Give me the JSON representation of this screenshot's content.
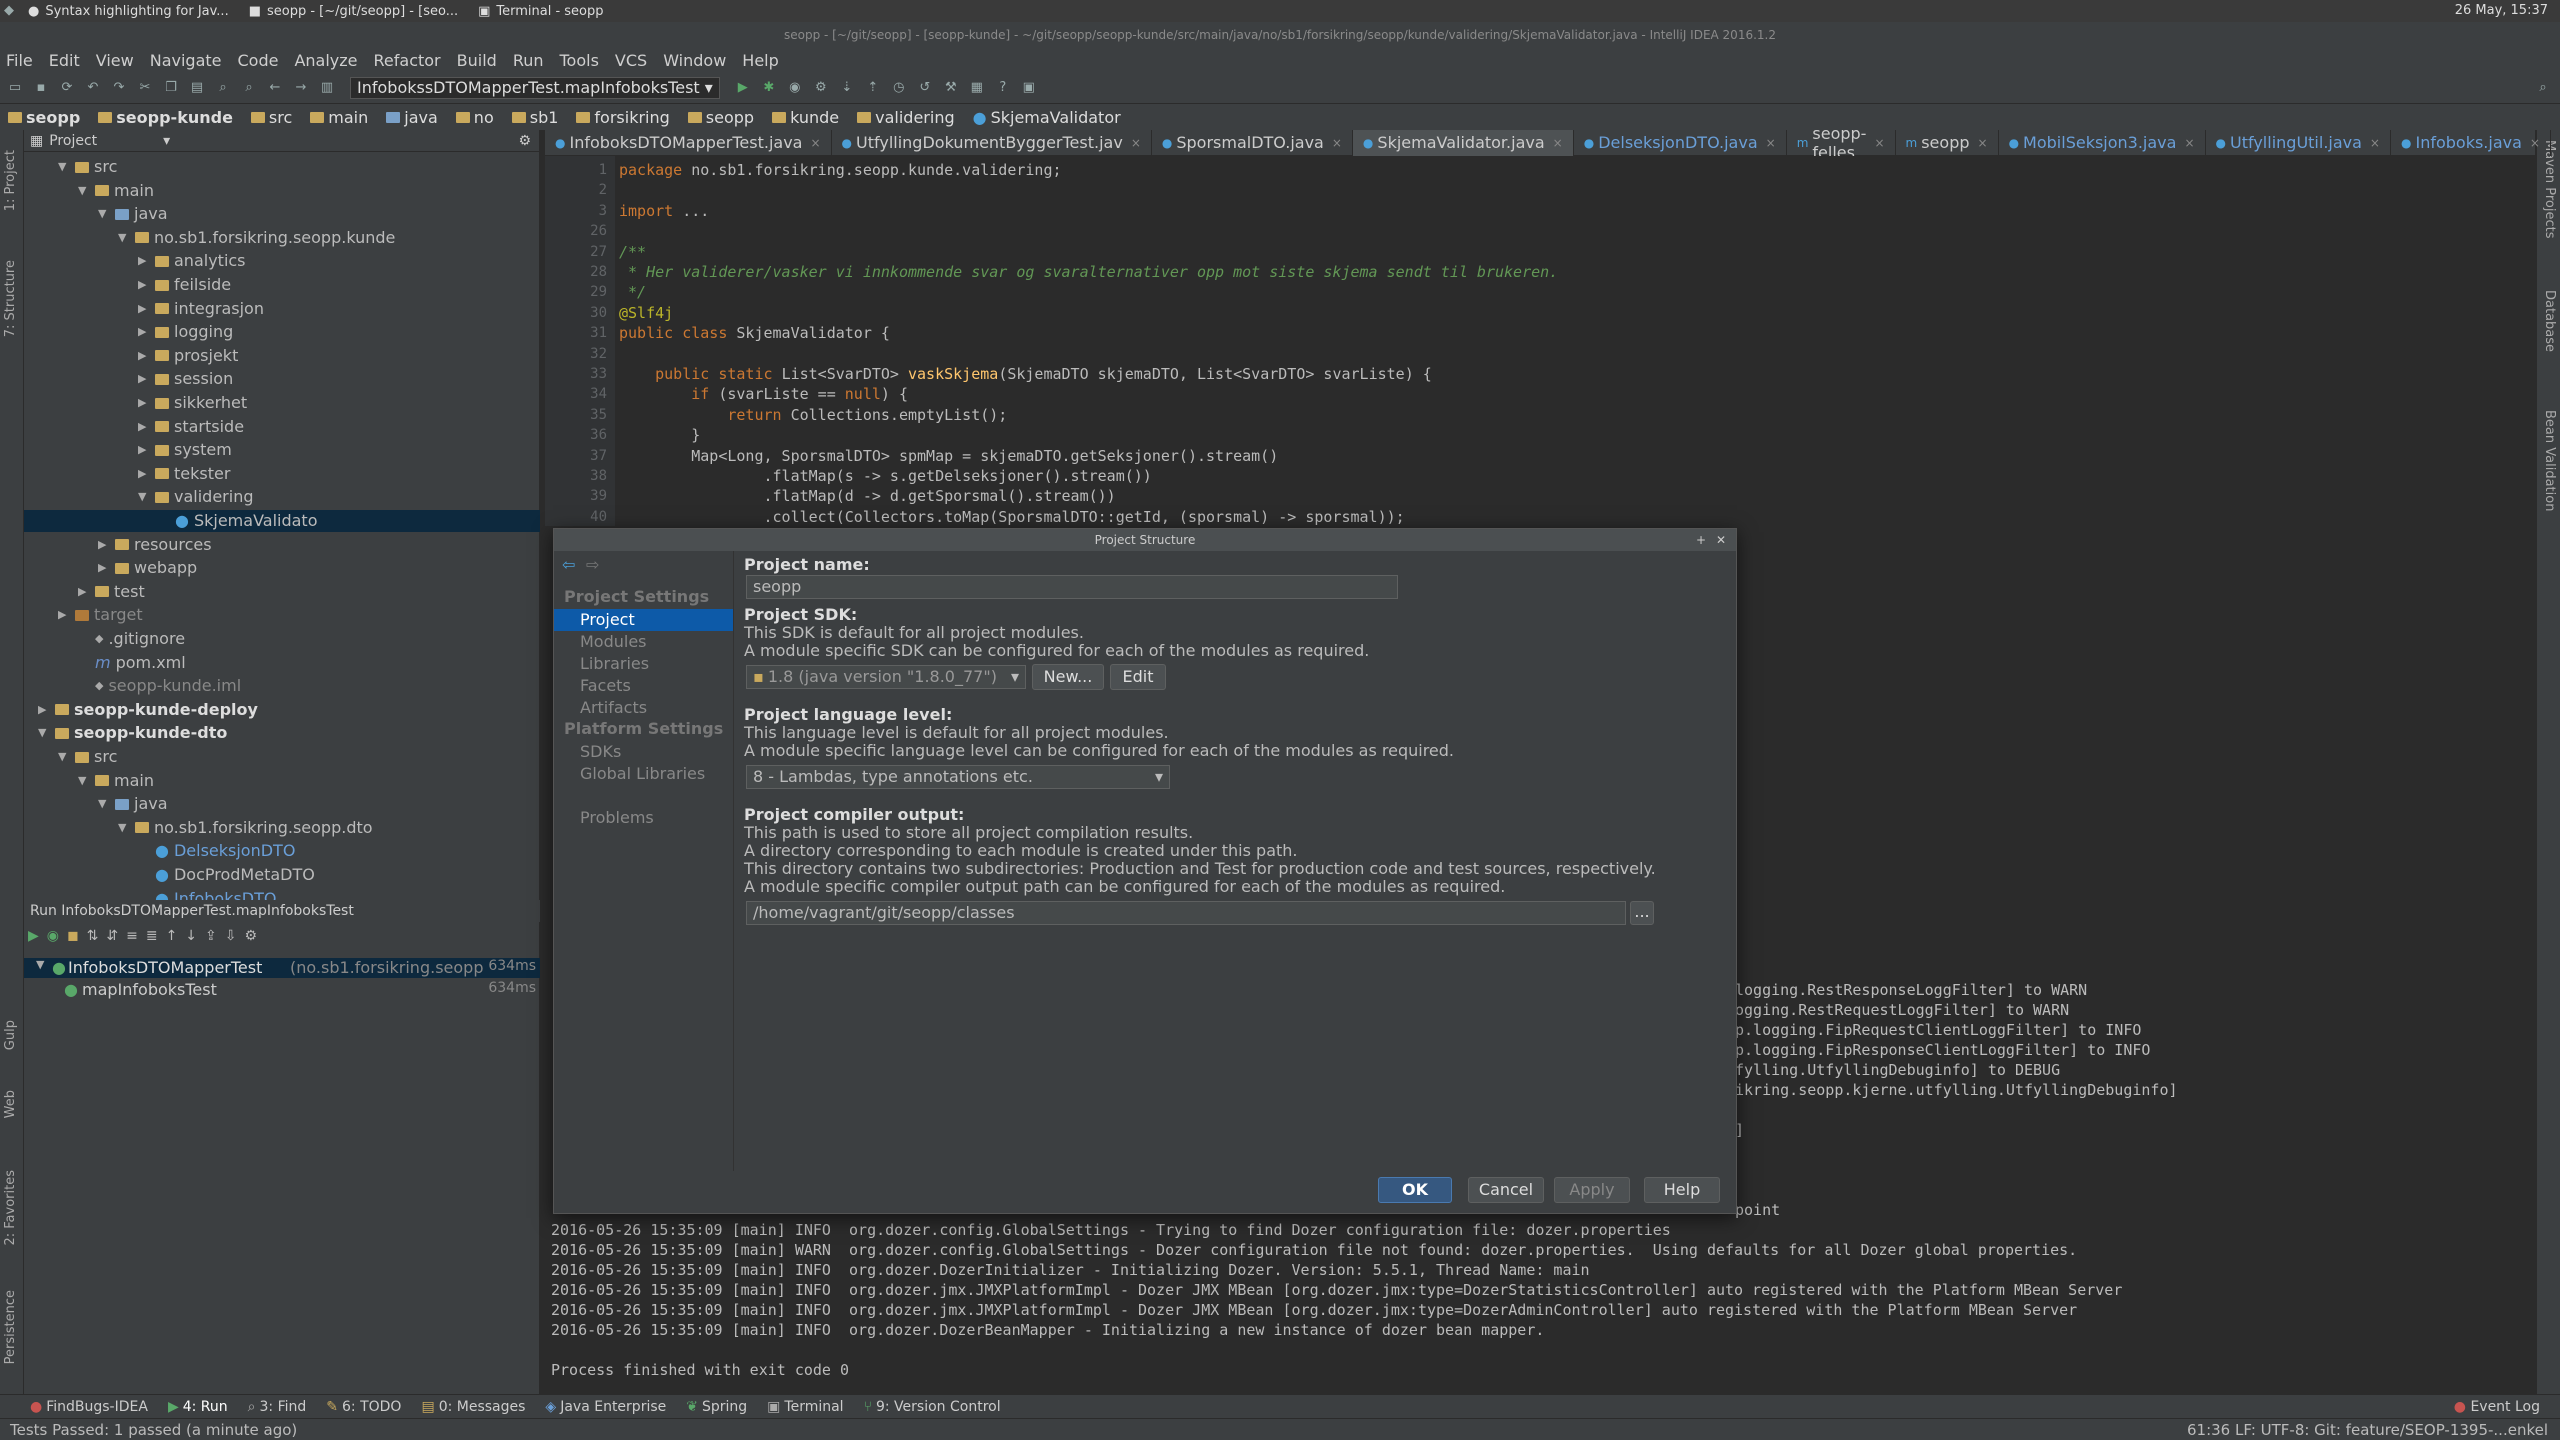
{
  "system": {
    "tasks": [
      "Syntax highlighting for Jav...",
      "seopp - [~/git/seopp] - [seo...",
      "Terminal - seopp"
    ],
    "clock": "26 May, 15:37"
  },
  "window_title": "seopp - [~/git/seopp] - [seopp-kunde] - ~/git/seopp/seopp-kunde/src/main/java/no/sb1/forsikring/seopp/kunde/validering/SkjemaValidator.java - IntelliJ IDEA 2016.1.2",
  "menu": [
    "File",
    "Edit",
    "View",
    "Navigate",
    "Code",
    "Analyze",
    "Refactor",
    "Build",
    "Run",
    "Tools",
    "VCS",
    "Window",
    "Help"
  ],
  "toolbar": {
    "run_config": "InfobokssDTOMapperTest.mapInfoboksTest"
  },
  "breadcrumb": [
    "seopp",
    "seopp-kunde",
    "src",
    "main",
    "java",
    "no",
    "sb1",
    "forsikring",
    "seopp",
    "kunde",
    "validering",
    "SkjemaValidator"
  ],
  "left_strip": [
    "1: Project",
    "7: Structure",
    "Gulp",
    "Web",
    "2: Favorites",
    "Persistence"
  ],
  "right_strip": [
    "Maven Projects",
    "Database",
    "Bean Validation"
  ],
  "project_panel": {
    "title": "Project",
    "tree": [
      {
        "label": "src",
        "depth": 2,
        "open": true,
        "icon": "folder"
      },
      {
        "label": "main",
        "depth": 3,
        "open": true,
        "icon": "folder"
      },
      {
        "label": "java",
        "depth": 4,
        "open": true,
        "icon": "folder-blue"
      },
      {
        "label": "no.sb1.forsikring.seopp.kunde",
        "depth": 5,
        "open": true,
        "icon": "folder"
      },
      {
        "label": "analytics",
        "depth": 6,
        "open": false,
        "icon": "folder"
      },
      {
        "label": "feilside",
        "depth": 6,
        "open": false,
        "icon": "folder"
      },
      {
        "label": "integrasjon",
        "depth": 6,
        "open": false,
        "icon": "folder"
      },
      {
        "label": "logging",
        "depth": 6,
        "open": false,
        "icon": "folder"
      },
      {
        "label": "prosjekt",
        "depth": 6,
        "open": false,
        "icon": "folder"
      },
      {
        "label": "session",
        "depth": 6,
        "open": false,
        "icon": "folder"
      },
      {
        "label": "sikkerhet",
        "depth": 6,
        "open": false,
        "icon": "folder"
      },
      {
        "label": "startside",
        "depth": 6,
        "open": false,
        "icon": "folder"
      },
      {
        "label": "system",
        "depth": 6,
        "open": false,
        "icon": "folder"
      },
      {
        "label": "tekster",
        "depth": 6,
        "open": false,
        "icon": "folder"
      },
      {
        "label": "validering",
        "depth": 6,
        "open": true,
        "icon": "folder"
      },
      {
        "label": "SkjemaValidato",
        "depth": 7,
        "open": null,
        "icon": "class",
        "selected": true
      },
      {
        "label": "resources",
        "depth": 4,
        "open": false,
        "icon": "folder"
      },
      {
        "label": "webapp",
        "depth": 4,
        "open": false,
        "icon": "folder"
      },
      {
        "label": "test",
        "depth": 3,
        "open": false,
        "icon": "folder"
      },
      {
        "label": "target",
        "depth": 2,
        "open": false,
        "icon": "folder-orange",
        "muted": true
      },
      {
        "label": ".gitignore",
        "depth": 3,
        "open": null,
        "icon": "file"
      },
      {
        "label": "pom.xml",
        "depth": 3,
        "open": null,
        "icon": "maven"
      },
      {
        "label": "seopp-kunde.iml",
        "depth": 3,
        "open": null,
        "icon": "file",
        "muted": true
      },
      {
        "label": "seopp-kunde-deploy",
        "depth": 1,
        "open": false,
        "icon": "module",
        "bold": true
      },
      {
        "label": "seopp-kunde-dto",
        "depth": 1,
        "open": true,
        "icon": "module",
        "bold": true
      },
      {
        "label": "src",
        "depth": 2,
        "open": true,
        "icon": "folder"
      },
      {
        "label": "main",
        "depth": 3,
        "open": true,
        "icon": "folder"
      },
      {
        "label": "java",
        "depth": 4,
        "open": true,
        "icon": "folder-blue"
      },
      {
        "label": "no.sb1.forsikring.seopp.dto",
        "depth": 5,
        "open": true,
        "icon": "folder"
      },
      {
        "label": "DelseksjonDTO",
        "depth": 6,
        "open": null,
        "icon": "class",
        "blue": true
      },
      {
        "label": "DocProdMetaDTO",
        "depth": 6,
        "open": null,
        "icon": "class"
      },
      {
        "label": "InfoboksDTO",
        "depth": 6,
        "open": null,
        "icon": "class",
        "blue": true
      }
    ]
  },
  "tabs": [
    "InfoboksDTOMapperTest.java",
    "UtfyllingDokumentByggerTest.jav",
    "SporsmalDTO.java",
    "SkjemaValidator.java",
    "DelseksjonDTO.java",
    "seopp-felles",
    "seopp",
    "MobilSeksjon3.java",
    "UtfyllingUtil.java",
    "Infoboks.java"
  ],
  "active_tab": 3,
  "code": {
    "line_numbers": [
      "1",
      "2",
      "3",
      "26",
      "27",
      "28",
      "29",
      "30",
      "31",
      "32",
      "33",
      "34",
      "35",
      "36",
      "37",
      "38",
      "39",
      "40"
    ],
    "lines": [
      [
        {
          "t": "package ",
          "c": "kw"
        },
        {
          "t": "no.sb1.forsikring.seopp.kunde.validering;",
          "c": ""
        }
      ],
      [],
      [
        {
          "t": "import ",
          "c": "kw"
        },
        {
          "t": "...",
          "c": ""
        }
      ],
      [],
      [
        {
          "t": "/**",
          "c": "cm"
        }
      ],
      [
        {
          "t": " * Her validerer/vasker vi innkommende svar og svaralternativer opp mot siste skjema sendt til brukeren.",
          "c": "cm"
        }
      ],
      [
        {
          "t": " */",
          "c": "cm"
        }
      ],
      [
        {
          "t": "@Slf4j",
          "c": "an"
        }
      ],
      [
        {
          "t": "public class ",
          "c": "kw"
        },
        {
          "t": "SkjemaValidator {",
          "c": ""
        }
      ],
      [],
      [
        {
          "t": "    public static ",
          "c": "kw"
        },
        {
          "t": "List<SvarDTO> ",
          "c": ""
        },
        {
          "t": "vaskSkjema",
          "c": "fn"
        },
        {
          "t": "(SkjemaDTO skjemaDTO, List<SvarDTO> svarListe) {",
          "c": ""
        }
      ],
      [
        {
          "t": "        if ",
          "c": "kw"
        },
        {
          "t": "(svarListe == ",
          "c": ""
        },
        {
          "t": "null",
          "c": "kw"
        },
        {
          "t": ") {",
          "c": ""
        }
      ],
      [
        {
          "t": "            return ",
          "c": "kw"
        },
        {
          "t": "Collections.emptyList();",
          "c": ""
        }
      ],
      [
        {
          "t": "        }",
          "c": ""
        }
      ],
      [
        {
          "t": "        Map<Long, SporsmalDTO> spmMap = skjemaDTO.getSeksjoner().stream()",
          "c": ""
        }
      ],
      [
        {
          "t": "                .flatMap(s -> s.getDelseksjoner().stream())",
          "c": ""
        }
      ],
      [
        {
          "t": "                .flatMap(d -> d.getSporsmal().stream())",
          "c": ""
        }
      ],
      [
        {
          "t": "                .collect(Collectors.toMap(SporsmalDTO::getId, (sporsmal) -> sporsmal));",
          "c": ""
        }
      ]
    ]
  },
  "run_panel": {
    "title": "Run  InfoboksDTOMapperTest.mapInfoboksTest",
    "test_root": "InfoboksDTOMapperTest",
    "test_root_pkg": "(no.sb1.forsikring.seopp",
    "test_root_time": "634ms",
    "test_child": "mapInfoboksTest",
    "test_child_time": "634ms"
  },
  "console": {
    "right_fragments": [
      "logging.RestResponseLoggFilter] to WARN",
      "ogging.RestRequestLoggFilter] to WARN",
      "p.logging.FipRequestClientLoggFilter] to INFO",
      "p.logging.FipResponseClientLoggFilter] to INFO",
      "fylling.UtfyllingDebuginfo] to DEBUG",
      "ikring.seopp.kjerne.utfylling.UtfyllingDebuginfo]",
      "]",
      "point"
    ],
    "lines": [
      "2016-05-26 15:35:09 [main] INFO  org.dozer.config.GlobalSettings - Trying to find Dozer configuration file: dozer.properties",
      "2016-05-26 15:35:09 [main] WARN  org.dozer.config.GlobalSettings - Dozer configuration file not found: dozer.properties.  Using defaults for all Dozer global properties.",
      "2016-05-26 15:35:09 [main] INFO  org.dozer.DozerInitializer - Initializing Dozer. Version: 5.5.1, Thread Name: main",
      "2016-05-26 15:35:09 [main] INFO  org.dozer.jmx.JMXPlatformImpl - Dozer JMX MBean [org.dozer.jmx:type=DozerStatisticsController] auto registered with the Platform MBean Server",
      "2016-05-26 15:35:09 [main] INFO  org.dozer.jmx.JMXPlatformImpl - Dozer JMX MBean [org.dozer.jmx:type=DozerAdminController] auto registered with the Platform MBean Server",
      "2016-05-26 15:35:09 [main] INFO  org.dozer.DozerBeanMapper - Initializing a new instance of dozer bean mapper.",
      "",
      "Process finished with exit code 0"
    ]
  },
  "dialog": {
    "title": "Project Structure",
    "sidebar": {
      "project_settings_header": "Project Settings",
      "project_settings": [
        "Project",
        "Modules",
        "Libraries",
        "Facets",
        "Artifacts"
      ],
      "platform_settings_header": "Platform Settings",
      "platform_settings": [
        "SDKs",
        "Global Libraries"
      ],
      "problems": "Problems"
    },
    "project_name_label": "Project name:",
    "project_name_value": "seopp",
    "sdk_label": "Project SDK:",
    "sdk_desc_1": "This SDK is default for all project modules.",
    "sdk_desc_2": "A module specific SDK can be configured for each of the modules as required.",
    "sdk_value": "1.8 (java version \"1.8.0_77\")",
    "sdk_new": "New...",
    "sdk_edit": "Edit",
    "lang_label": "Project language level:",
    "lang_desc_1": "This language level is default for all project modules.",
    "lang_desc_2": "A module specific language level can be configured for each of the modules as required.",
    "lang_value": "8 - Lambdas, type annotations etc.",
    "compiler_label": "Project compiler output:",
    "compiler_desc_1": "This path is used to store all project compilation results.",
    "compiler_desc_2": "A directory corresponding to each module is created under this path.",
    "compiler_desc_3": "This directory contains two subdirectories: Production and Test for production code and test sources, respectively.",
    "compiler_desc_4": "A module specific compiler output path can be configured for each of the modules as required.",
    "compiler_value": "/home/vagrant/git/seopp/classes",
    "browse": "...",
    "ok": "OK",
    "cancel": "Cancel",
    "apply": "Apply",
    "help": "Help"
  },
  "bottom_tabs": [
    "FindBugs-IDEA",
    "4: Run",
    "3: Find",
    "6: TODO",
    "0: Messages",
    "Java Enterprise",
    "Spring",
    "Terminal",
    "9: Version Control"
  ],
  "event_log": "Event Log",
  "status": {
    "left": "Tests Passed: 1 passed (a minute ago)",
    "right": "61:36   LF:  UTF-8:  Git: feature/SEOP-1395-...enkel"
  },
  "colors": {
    "accent": "#0d5aa8",
    "editor_bg": "#2b2b2b",
    "panel_bg": "#3c3f41",
    "keyword": "#cc7832",
    "comment": "#629755"
  }
}
